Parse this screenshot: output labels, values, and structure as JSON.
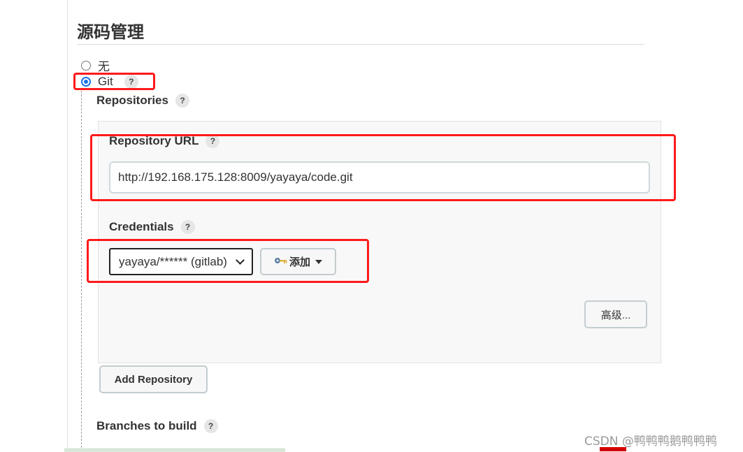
{
  "section": {
    "title": "源码管理"
  },
  "scm_options": [
    {
      "label": "无",
      "checked": false
    },
    {
      "label": "Git",
      "checked": true
    }
  ],
  "help_label": "?",
  "repositories": {
    "label": "Repositories",
    "repository_url": {
      "label": "Repository URL",
      "value": "http://192.168.175.128:8009/yayaya/code.git"
    },
    "credentials": {
      "label": "Credentials",
      "selected": "yayaya/****** (gitlab)",
      "add_button": "添加"
    },
    "advanced_button": "高级...",
    "add_repository_button": "Add Repository"
  },
  "branches": {
    "label": "Branches to build"
  },
  "watermark": "CSDN @鸭鸭鸭鹅鸭鸭鸭",
  "colors": {
    "highlight": "#ff1a1a",
    "radio_accent": "#1a73e8"
  }
}
